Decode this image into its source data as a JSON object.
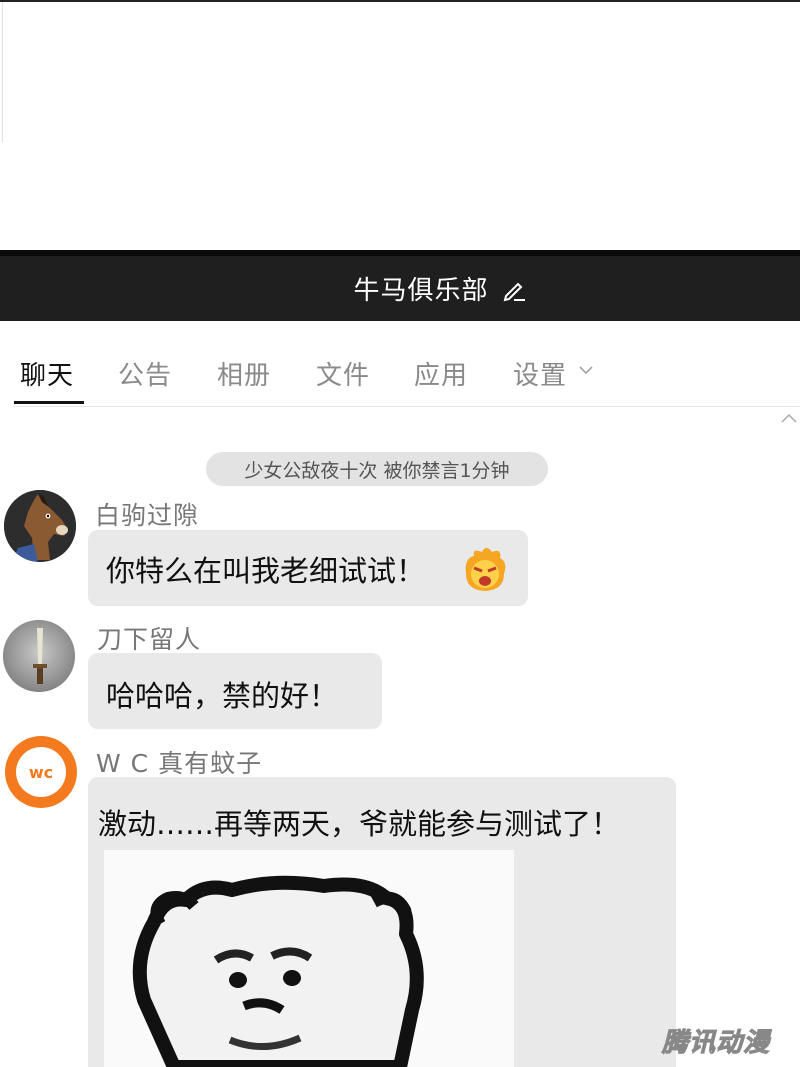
{
  "group": {
    "title": "牛马俱乐部"
  },
  "tabs": [
    "聊天",
    "公告",
    "相册",
    "文件",
    "应用",
    "设置"
  ],
  "notice": "少女公敌夜十次 被你禁言1分钟",
  "messages": [
    {
      "sender": "白驹过隙",
      "text": "你特么在叫我老细试试！"
    },
    {
      "sender": "刀下留人",
      "text": "哈哈哈，禁的好！"
    },
    {
      "sender": "W C 真有蚊子",
      "text": "激动……再等两天，爷就能参与测试了！",
      "avatar_text": "wc"
    }
  ],
  "watermark": "腾讯动漫",
  "colors": {
    "header_bg": "#1f1f1f",
    "bubble_bg": "#e9e9e9",
    "wc_orange": "#f47a1f"
  }
}
